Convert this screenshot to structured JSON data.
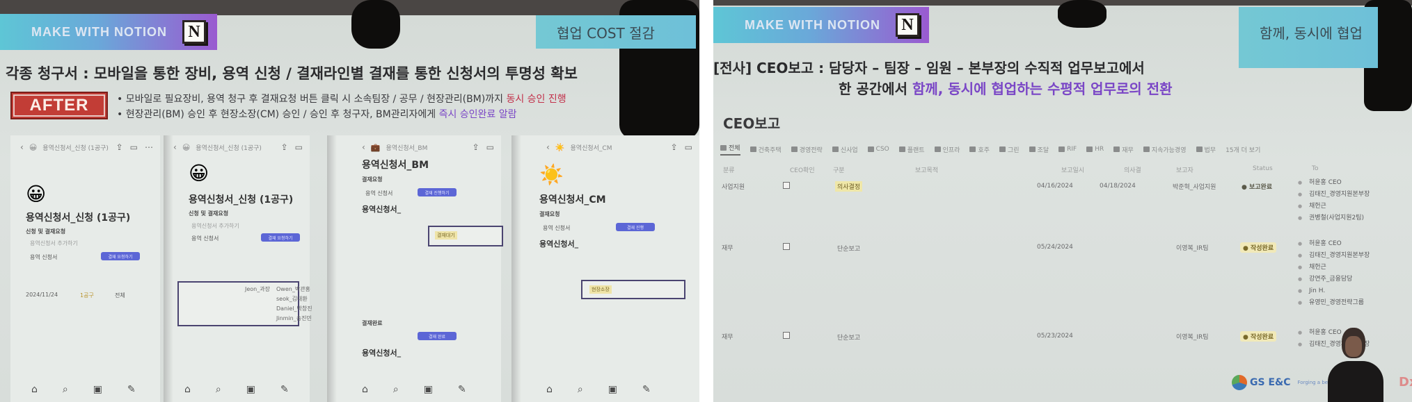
{
  "left_slide": {
    "brand": "MAKE WITH NOTION",
    "brand_logo": "N",
    "section_tag": "협업 COST 절감",
    "headline": "각종 청구서 : 모바일을 통한 장비, 용역 신청 / 결재라인별 결재를 통한 신청서의 투명성 확보",
    "after_badge": "AFTER",
    "bullets": [
      {
        "text": "모바일로 필요장비, 용역 청구 후 결재요청 버튼 클릭 시 소속팀장 / 공무 / 현장관리(BM)까지 ",
        "highlight": "동시 승인 진행",
        "highlight_color": "#c2304a"
      },
      {
        "text": "현장관리(BM) 승인 후 현장소장(CM) 승인 / 승인 후 청구자, BM관리자에게 ",
        "highlight": "즉시 승인완료 알람",
        "highlight_color": "#7a46c6"
      }
    ],
    "phones": [
      {
        "nav_title": "용역신청서_신청 (1공구)",
        "emoji": "😀",
        "title": "용역신청서_신청 (1공구)",
        "section": "신청 및 결재요청",
        "link": "용역신청서 추가하기",
        "db_label": "용역 신청서",
        "button": "결재 요청하기",
        "meta_date": "2024/11/24",
        "meta_tag": "1공구",
        "meta_status": "전체"
      },
      {
        "nav_title": "용역신청서_신청 (1공구)",
        "emoji": "😀",
        "title": "용역신청서_신청 (1공구)",
        "section": "신청 및 결재요청",
        "link": "용역신청서 추가하기",
        "db_label": "용역 신청서",
        "button": "결재 요청하기",
        "approvers": [
          "Jeon_과장",
          "Owen_박관홍",
          "seok_김대환",
          "Daniel_박창진",
          "Jinmin_송진민"
        ]
      },
      {
        "nav_title": "용역신청서_BM",
        "emoji": "💼",
        "title": "용역신청서_BM",
        "section": "결재요청",
        "db_label": "용역 신청서",
        "button": "결재 진행하기",
        "linked": "용역신청서_",
        "tag": "결재대기",
        "done_section": "결재완료",
        "done_button": "결재 완료"
      },
      {
        "nav_title": "용역신청서_CM",
        "emoji": "☀️",
        "title": "용역신청서_CM",
        "section": "결재요청",
        "db_label": "용역 신청서",
        "button": "결재 진행",
        "linked": "용역신청서_",
        "tag": "현장소장"
      }
    ],
    "tabbar_icons": [
      "home-icon",
      "search-icon",
      "inbox-icon",
      "compose-icon"
    ]
  },
  "right_slide": {
    "brand": "MAKE WITH NOTION",
    "brand_logo": "N",
    "section_tag": "함께, 동시에 협업",
    "headline_line1": "[전사] CEO보고 : 담당자 – 팀장 – 임원 – 본부장의 수직적 업무보고에서",
    "headline_line2_plain": "한 공간에서 ",
    "headline_line2_highlight": "함께, 동시에 협업하는 수평적 업무로의 전환",
    "page_title": "CEO보고",
    "tabs": [
      "전체",
      "건축주택",
      "경영전략",
      "신사업",
      "CSO",
      "플랜트",
      "인프라",
      "호주",
      "그린",
      "조달",
      "RIF",
      "HR",
      "재무",
      "지속가능경영",
      "법무"
    ],
    "tabs_more": "15개 더 보기",
    "columns": [
      "분류",
      "CEO확인",
      "구분",
      "보고목적",
      "보고일시",
      "의사결",
      "보고자",
      "Status",
      "To"
    ],
    "rows": [
      {
        "category": "사업지원",
        "checked": false,
        "type": "의사결정",
        "type_style": "yellow",
        "report_date": "04/16/2024",
        "decision_date": "04/18/2024",
        "reporter": "박준혁_사업지원",
        "status": "보고완료",
        "status_style": "done",
        "to": [
          "허윤홍 CEO",
          "김태진_경영지원본부장",
          "채헌근",
          "권병철(사업지원2팀)"
        ]
      },
      {
        "category": "재무",
        "checked": false,
        "type": "단순보고",
        "type_style": "plain",
        "report_date": "05/24/2024",
        "decision_date": "",
        "reporter": "이영복_IR팀",
        "status": "작성완료",
        "status_style": "written",
        "to": [
          "허윤홍 CEO",
          "김태진_경영지원본부장",
          "채헌근",
          "강연주_금융담당",
          "Jin H.",
          "유영민_경영전략그룹"
        ]
      },
      {
        "category": "재무",
        "checked": false,
        "type": "단순보고",
        "type_style": "plain",
        "report_date": "05/23/2024",
        "decision_date": "",
        "reporter": "이영복_IR팀",
        "status": "작성완료",
        "status_style": "written",
        "to": [
          "허윤홍 CEO",
          "김태진_경영지원본부장"
        ]
      }
    ],
    "footer_logo": "GS E&C",
    "footer_tagline": "Forging a better Tomorrow"
  }
}
